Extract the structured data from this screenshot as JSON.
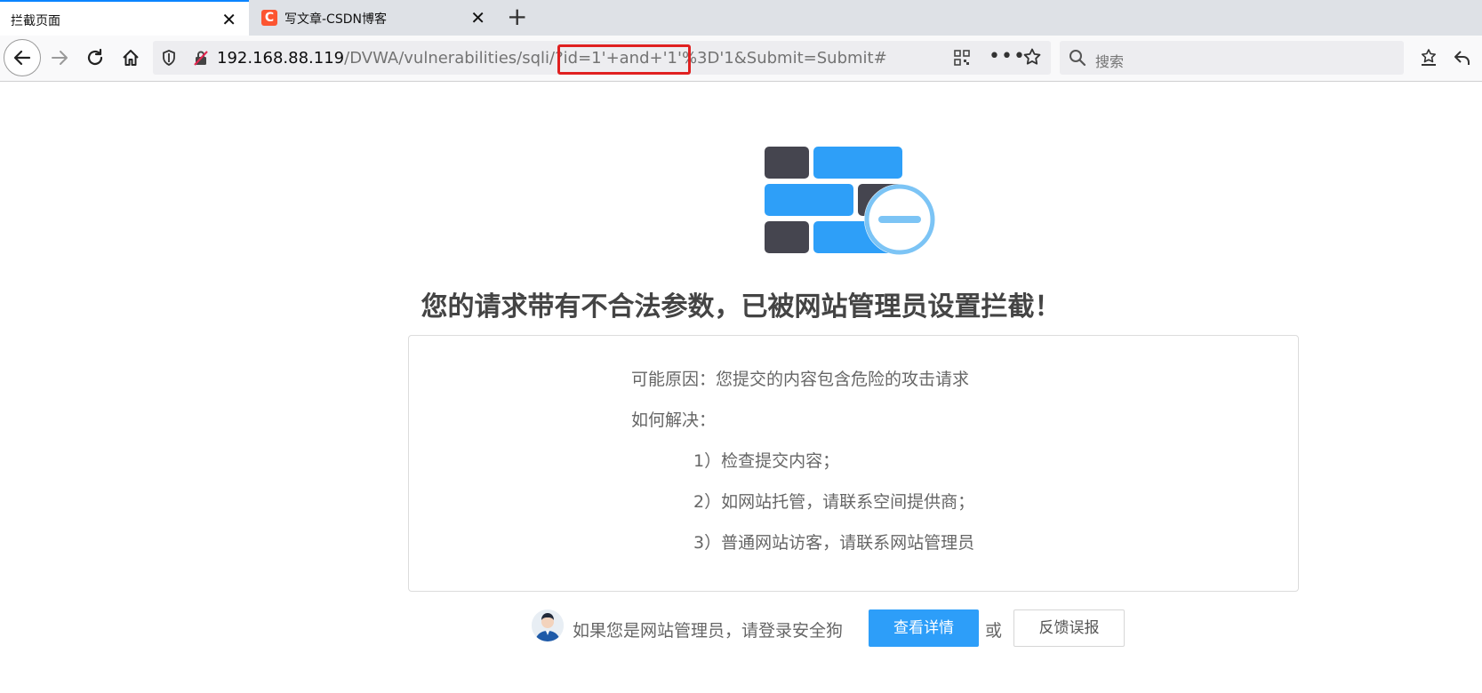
{
  "tabs": [
    {
      "title": "拦截页面",
      "active": true
    },
    {
      "title": "写文章-CSDN博客",
      "active": false,
      "favicon": "C"
    }
  ],
  "navbar": {
    "url_host": "192.168.88.119",
    "url_path": "/DVWA/vulnerabilities/sqli/?id=1'+and+'1'%3D'1&Submit=Submit#",
    "search_placeholder": "搜索"
  },
  "page": {
    "headline": "您的请求带有不合法参数，已被网站管理员设置拦截！",
    "reason": "可能原因：您提交的内容包含危险的攻击请求",
    "how_to": "如何解决：",
    "steps": [
      "1）检查提交内容；",
      "2）如网站托管，请联系空间提供商；",
      "3）普通网站访客，请联系网站管理员"
    ],
    "admin_prompt": "如果您是网站管理员，请登录安全狗",
    "detail_button": "查看详情",
    "or_text": "或",
    "feedback_button": "反馈误报"
  },
  "colors": {
    "accent": "#2d9ef9",
    "wall_dark": "#45454f",
    "wall_blue": "#2e9ff8",
    "highlight_red": "#e02020"
  }
}
